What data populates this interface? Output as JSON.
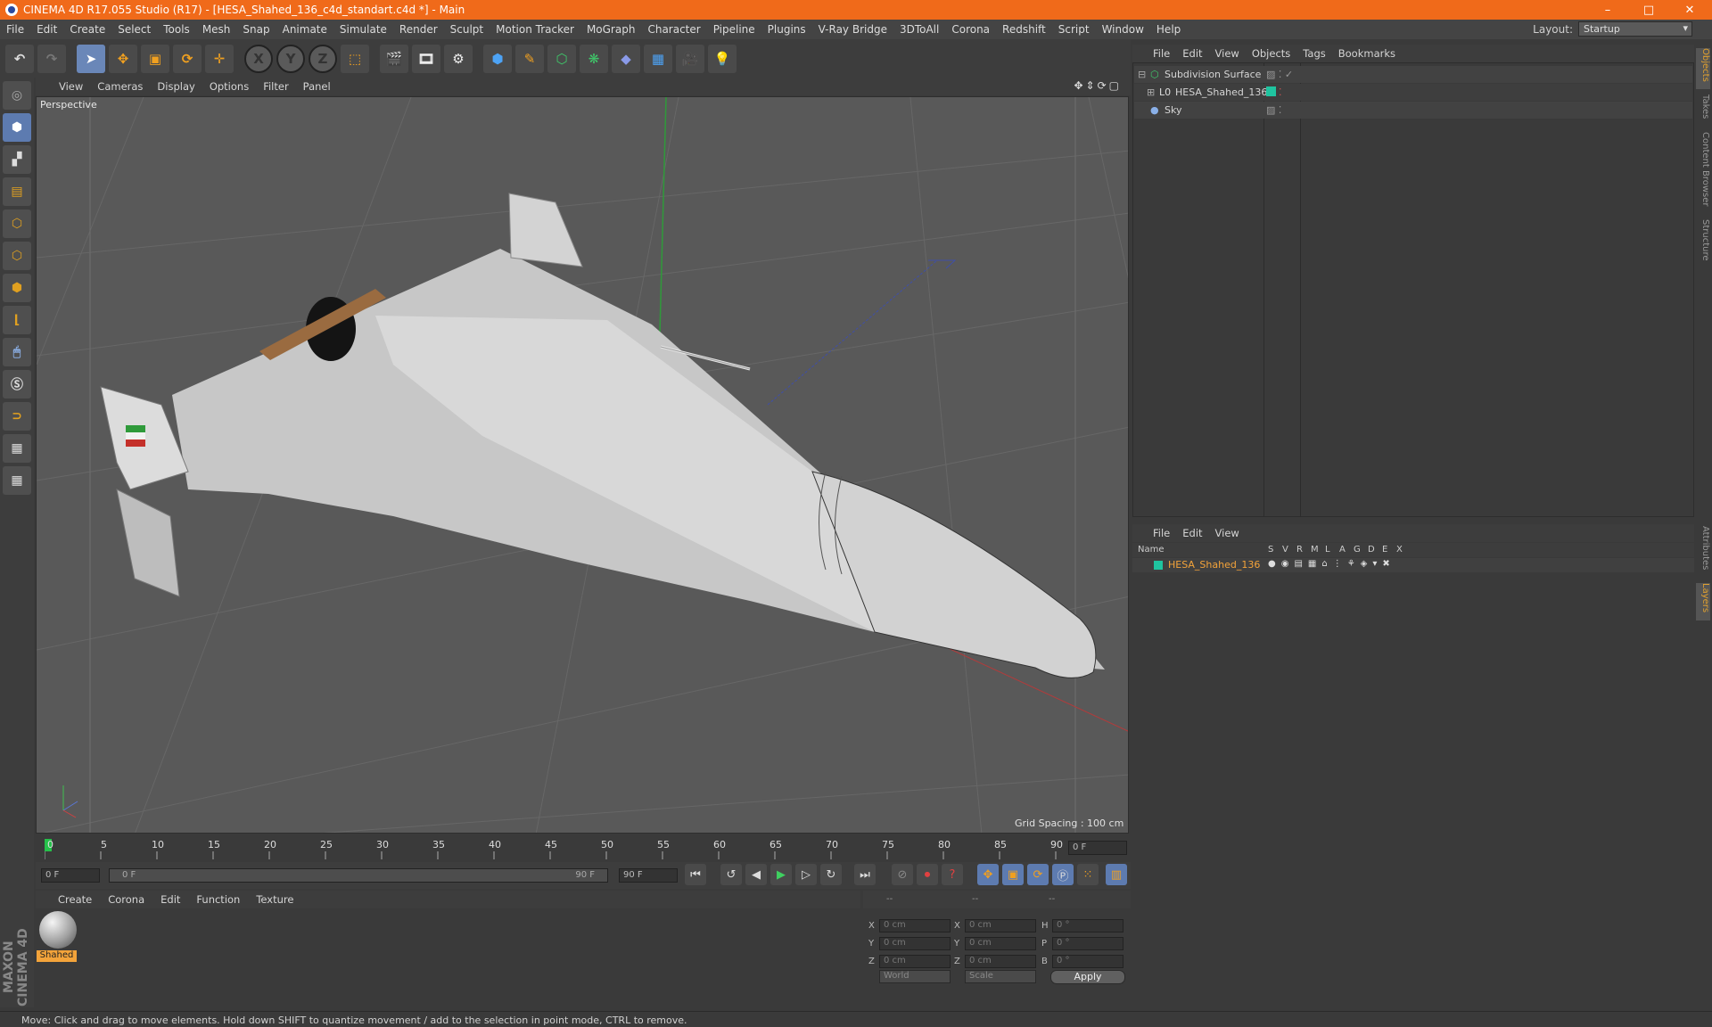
{
  "window": {
    "title": "CINEMA 4D R17.055 Studio (R17) - [HESA_Shahed_136_c4d_standart.c4d *] - Main",
    "minimize": "–",
    "maximize": "□",
    "close": "✕"
  },
  "menu": [
    "File",
    "Edit",
    "Create",
    "Select",
    "Tools",
    "Mesh",
    "Snap",
    "Animate",
    "Simulate",
    "Render",
    "Sculpt",
    "Motion Tracker",
    "MoGraph",
    "Character",
    "Pipeline",
    "Plugins",
    "V-Ray Bridge",
    "3DToAll",
    "Corona",
    "Redshift",
    "Script",
    "Window",
    "Help"
  ],
  "layout": {
    "label": "Layout:",
    "value": "Startup"
  },
  "toolbar": {
    "x": "X",
    "y": "Y",
    "z": "Z"
  },
  "viewport": {
    "menu": [
      "View",
      "Cameras",
      "Display",
      "Options",
      "Filter",
      "Panel"
    ],
    "label": "Perspective",
    "grid_spacing": "Grid Spacing : 100 cm"
  },
  "timeline": {
    "ticks": [
      "0",
      "5",
      "10",
      "15",
      "20",
      "25",
      "30",
      "35",
      "40",
      "45",
      "50",
      "55",
      "60",
      "65",
      "70",
      "75",
      "80",
      "85",
      "90"
    ],
    "current_frame": "0 F",
    "start": "0 F",
    "range_start": "0 F",
    "range_end": "90 F",
    "end": "90 F"
  },
  "material_manager": {
    "menu": [
      "Create",
      "Corona",
      "Edit",
      "Function",
      "Texture"
    ],
    "material_name": "Shahed"
  },
  "coordinates": {
    "header": [
      "--",
      "--",
      "--"
    ],
    "labels_pos": [
      "X",
      "Y",
      "Z"
    ],
    "labels_size": [
      "X",
      "Y",
      "Z"
    ],
    "labels_rot": [
      "H",
      "P",
      "B"
    ],
    "pos": [
      "0 cm",
      "0 cm",
      "0 cm"
    ],
    "size": [
      "0 cm",
      "0 cm",
      "0 cm"
    ],
    "rot": [
      "0 °",
      "0 °",
      "0 °"
    ],
    "world": "World",
    "scale": "Scale",
    "apply": "Apply"
  },
  "object_manager": {
    "menu": [
      "File",
      "Edit",
      "View",
      "Objects",
      "Tags",
      "Bookmarks"
    ],
    "objects": [
      "Subdivision Surface",
      "HESA_Shahed_136",
      "Sky"
    ]
  },
  "layer_manager": {
    "menu": [
      "File",
      "Edit",
      "View"
    ],
    "name_header": "Name",
    "columns": [
      "S",
      "V",
      "R",
      "M",
      "L",
      "A",
      "G",
      "D",
      "E",
      "X"
    ],
    "layer": "HESA_Shahed_136"
  },
  "right_tabs": [
    "Objects",
    "Takes",
    "Content Browser",
    "Structure",
    "Attributes",
    "Layers"
  ],
  "status": "Move: Click and drag to move elements. Hold down SHIFT to quantize movement / add to the selection in point mode, CTRL to remove.",
  "brand": "MAXON CINEMA 4D",
  "colors": {
    "title_bar": "#f06a1a",
    "accent_orange": "#f3a33a",
    "selection_blue": "#5d7bb0",
    "layer_green": "#1fc4a0"
  }
}
